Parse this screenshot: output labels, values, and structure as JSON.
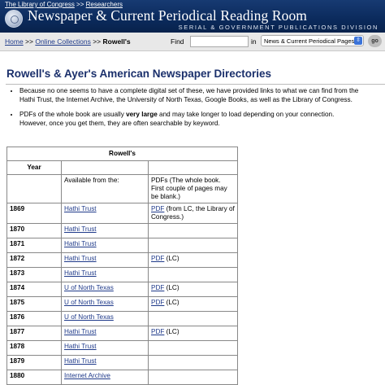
{
  "banner": {
    "crumb_library": "The Library of Congress",
    "crumb_sep": " >> ",
    "crumb_researchers": "Researchers",
    "site_title": "Newspaper & Current Periodical Reading Room",
    "site_subtitle": "SERIAL & GOVERNMENT PUBLICATIONS DIVISION"
  },
  "searchbar": {
    "bc_home": "Home",
    "bc_sep": " >> ",
    "bc_online": "Online Collections",
    "bc_current": "Rowell's",
    "find_label": "Find",
    "find_value": "",
    "in_label": "in",
    "scope_selected": "News & Current Periodical Pages",
    "go_label": "go"
  },
  "main": {
    "title": "Rowell's & Ayer's American Newspaper Directories",
    "note1": "Because no one seems to have a complete digital set of these, we have provided links to what we can find from the Hathi Trust, the Internet Archive, the University of North Texas, Google Books, as well as the Library of Congress.",
    "note2_pre": "PDFs of the whole book are usually ",
    "note2_strong": "very large",
    "note2_post": " and may take longer to load depending on your connection. However, once you get them, they are often searchable by keyword."
  },
  "table": {
    "caption": "Rowell's",
    "year_header": "Year",
    "available_header": "Available from the:",
    "pdf_header": "PDFs (The whole book. First couple of pages may be blank.)",
    "rows": [
      {
        "year": "1869",
        "source": "Hathi Trust",
        "pdf_link": "PDF",
        "pdf_note": " (from LC, the Library of Congress.)"
      },
      {
        "year": "1870",
        "source": "Hathi Trust",
        "pdf_link": "",
        "pdf_note": ""
      },
      {
        "year": "1871",
        "source": "Hathi Trust",
        "pdf_link": "",
        "pdf_note": ""
      },
      {
        "year": "1872",
        "source": "Hathi Trust",
        "pdf_link": "PDF",
        "pdf_note": " (LC)"
      },
      {
        "year": "1873",
        "source": "Hathi Trust",
        "pdf_link": "",
        "pdf_note": ""
      },
      {
        "year": "1874",
        "source": "U of North Texas",
        "pdf_link": "PDF",
        "pdf_note": " (LC)"
      },
      {
        "year": "1875",
        "source": "U of North Texas",
        "pdf_link": "PDF",
        "pdf_note": " (LC)"
      },
      {
        "year": "1876",
        "source": "U of North Texas",
        "pdf_link": "",
        "pdf_note": ""
      },
      {
        "year": "1877",
        "source": "Hathi Trust",
        "pdf_link": "PDF",
        "pdf_note": " (LC)"
      },
      {
        "year": "1878",
        "source": "Hathi Trust",
        "pdf_link": "",
        "pdf_note": ""
      },
      {
        "year": "1879",
        "source": "Hathi Trust",
        "pdf_link": "",
        "pdf_note": ""
      },
      {
        "year": "1880",
        "source": "Internet Archive",
        "pdf_link": "",
        "pdf_note": ""
      }
    ]
  }
}
